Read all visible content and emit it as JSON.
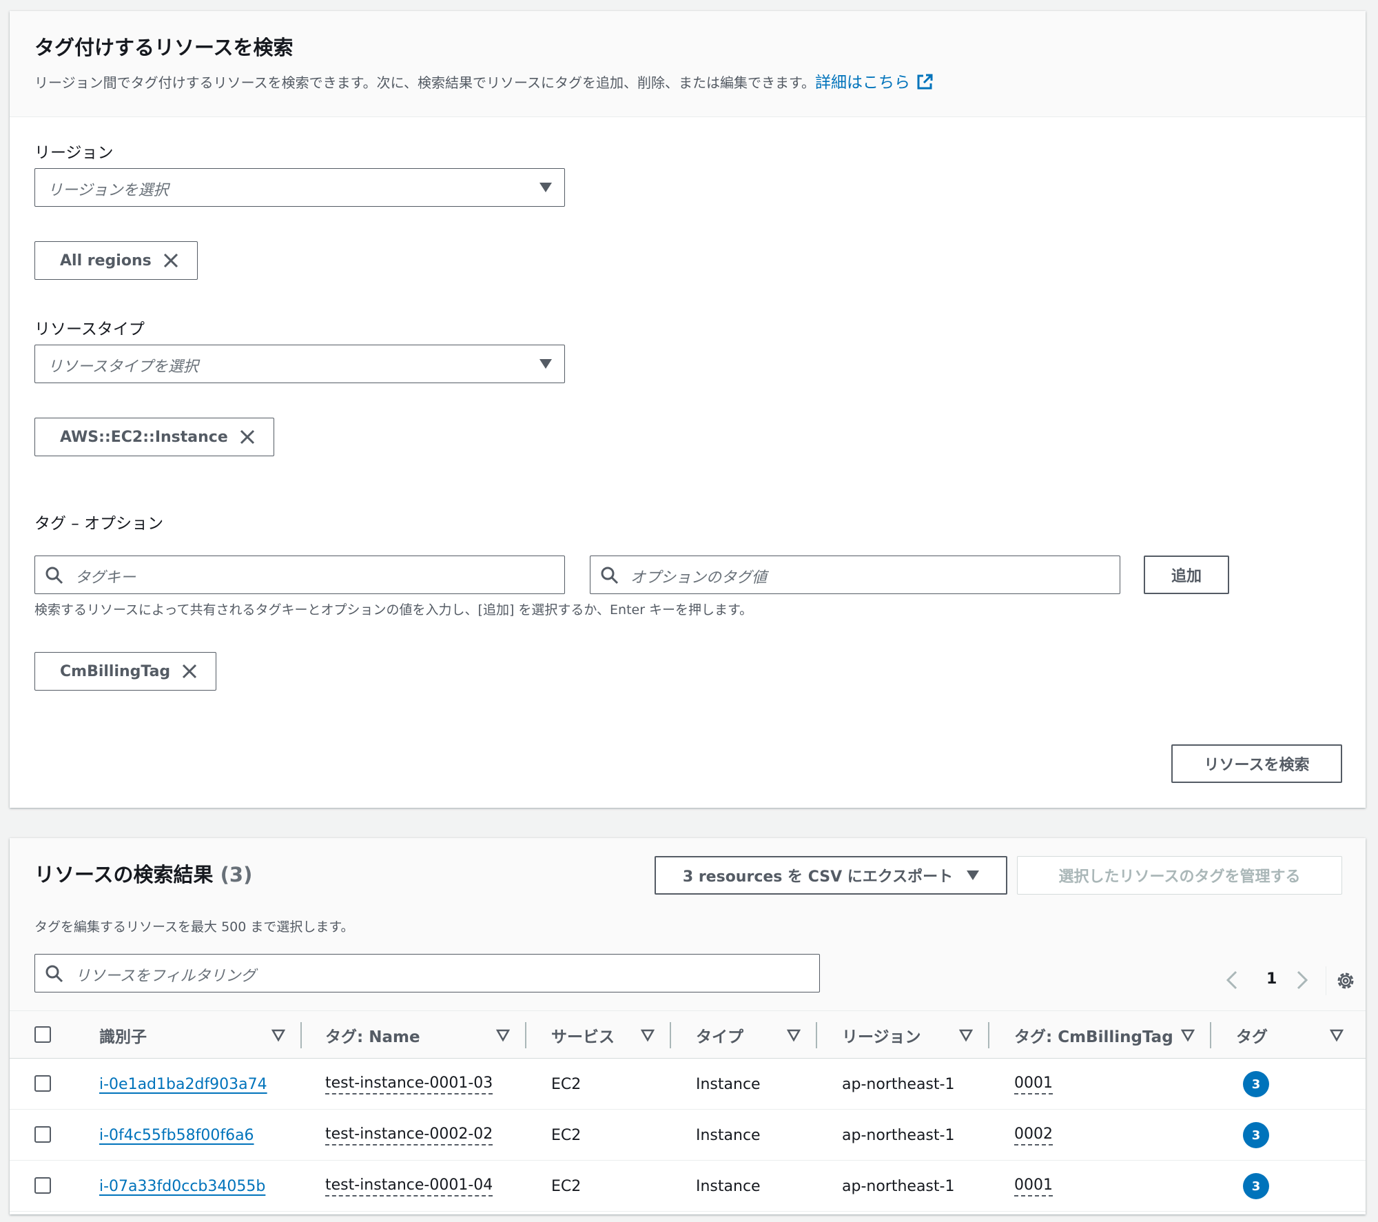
{
  "search": {
    "title": "タグ付けするリソースを検索",
    "description": "リージョン間でタグ付けするリソースを検索できます。次に、検索結果でリソースにタグを追加、削除、または編集できます。",
    "learn_more": "詳細はこちら",
    "region_label": "リージョン",
    "region_placeholder": "リージョンを選択",
    "region_token": "All regions",
    "resource_type_label": "リソースタイプ",
    "resource_type_placeholder": "リソースタイプを選択",
    "resource_type_token": "AWS::EC2::Instance",
    "tags_label": "タグ – オプション",
    "tag_key_placeholder": "タグキー",
    "tag_value_placeholder": "オプションのタグ値",
    "add_button": "追加",
    "tag_hint": "検索するリソースによって共有されるタグキーとオプションの値を入力し、[追加] を選択するか、Enter キーを押します。",
    "tag_token": "CmBillingTag",
    "search_button": "リソースを検索"
  },
  "results": {
    "title": "リソースの検索結果",
    "count": "(3)",
    "export_button": "3 resources を CSV にエクスポート",
    "manage_button": "選択したリソースのタグを管理する",
    "description": "タグを編集するリソースを最大 500 まで選択します。",
    "filter_placeholder": "リソースをフィルタリング",
    "page": "1",
    "columns": [
      "識別子",
      "タグ: Name",
      "サービス",
      "タイプ",
      "リージョン",
      "タグ: CmBillingTag",
      "タグ"
    ],
    "rows": [
      {
        "id": "i-0e1ad1ba2df903a74",
        "name": "test-instance-0001-03",
        "service": "EC2",
        "type": "Instance",
        "region": "ap-northeast-1",
        "billing": "0001",
        "tags": "3"
      },
      {
        "id": "i-0f4c55fb58f00f6a6",
        "name": "test-instance-0002-02",
        "service": "EC2",
        "type": "Instance",
        "region": "ap-northeast-1",
        "billing": "0002",
        "tags": "3"
      },
      {
        "id": "i-07a33fd0ccb34055b",
        "name": "test-instance-0001-04",
        "service": "EC2",
        "type": "Instance",
        "region": "ap-northeast-1",
        "billing": "0001",
        "tags": "3"
      }
    ]
  },
  "colors": {
    "link": "#0073bb",
    "badge": "#0073bb",
    "border": "#545b64",
    "background": "#f2f3f3"
  },
  "icons": [
    "external-link-icon",
    "caret-down-icon",
    "close-icon",
    "search-icon",
    "chevron-left-icon",
    "chevron-right-icon",
    "gear-icon",
    "sort-icon"
  ]
}
